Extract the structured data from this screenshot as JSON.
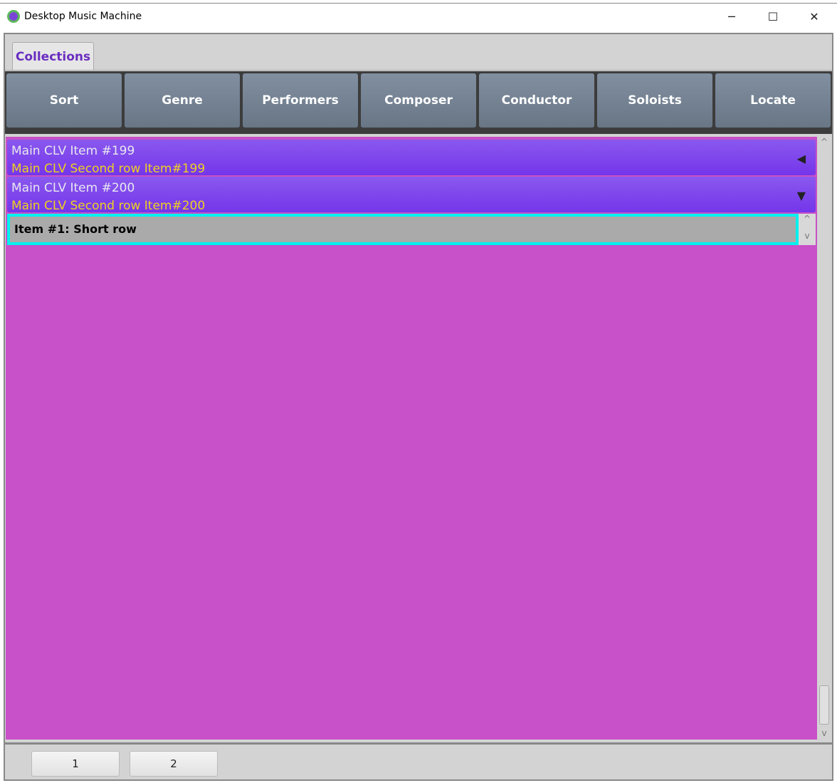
{
  "window": {
    "title": "Desktop Music Machine",
    "minimize": "─",
    "maximize": "☐",
    "close": "✕"
  },
  "tabs": [
    {
      "label": "Collections",
      "selected": true
    }
  ],
  "toolbar": [
    "Sort",
    "Genre",
    "Performers",
    "Composer",
    "Conductor",
    "Soloists",
    "Locate"
  ],
  "list": {
    "items": [
      {
        "line1": "Main CLV Item #199",
        "line2": "Main CLV Second row Item#199",
        "arrow": "◀",
        "expanded": false
      },
      {
        "line1": "Main CLV Item #200",
        "line2": "Main CLV Second row Item#200",
        "arrow": "▼",
        "expanded": true
      }
    ],
    "sub_items": [
      {
        "label": "Item #1: Short row",
        "selected": true
      }
    ]
  },
  "scroll": {
    "up": "^",
    "down": "v"
  },
  "pages": [
    "1",
    "2"
  ],
  "colors": {
    "list_bg": "#c850c8",
    "row": "#7f45ec",
    "line2": "#f0d020",
    "selection": "#00f0f0",
    "tab_text": "#6a2ec0"
  }
}
